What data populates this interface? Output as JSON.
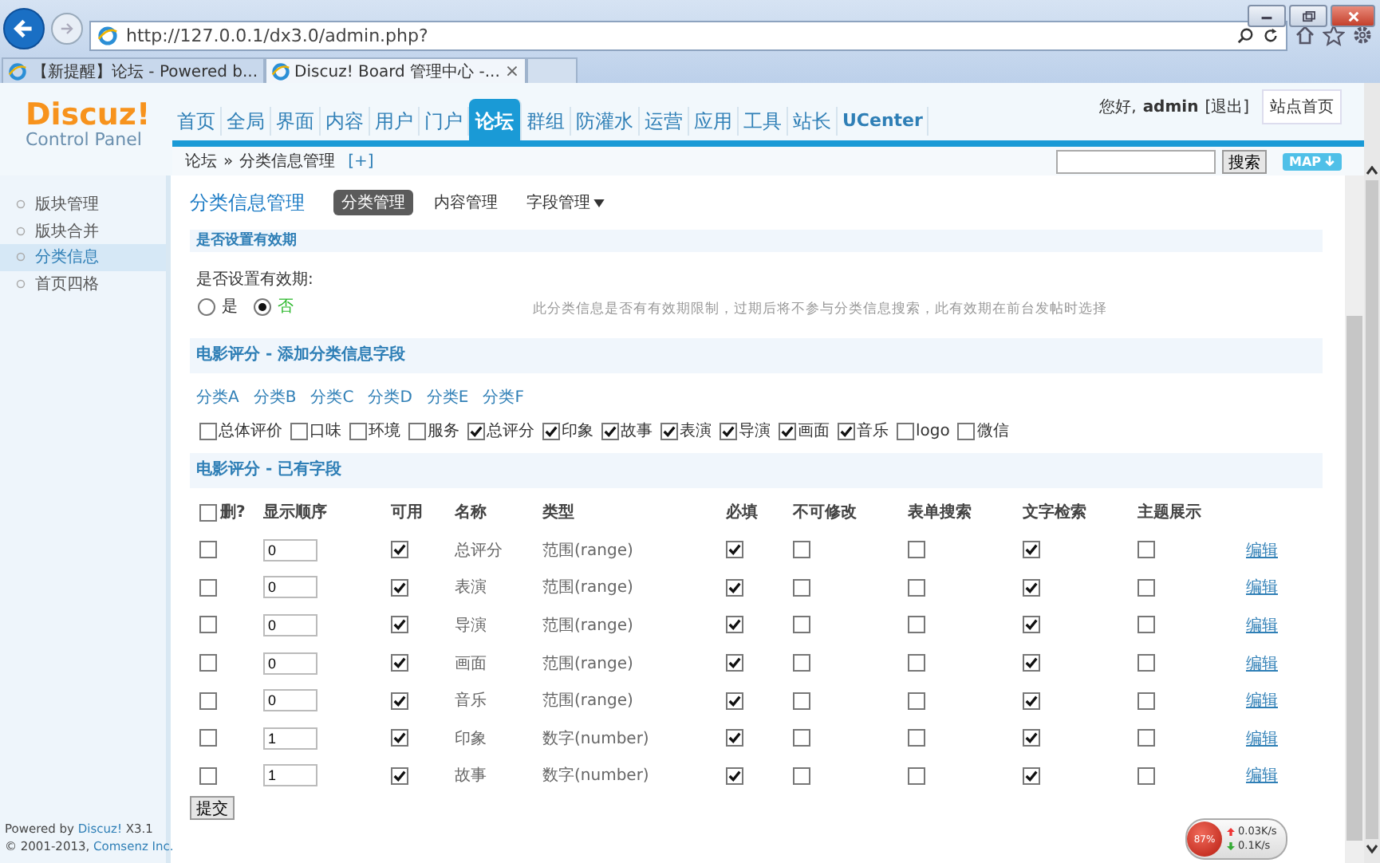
{
  "browser": {
    "address": "http://127.0.0.1/dx3.0/admin.php?",
    "tabs": [
      {
        "label": "【新提醒】论坛 - Powered b...",
        "selected": false
      },
      {
        "label": "Discuz! Board 管理中心 -...",
        "selected": true
      }
    ],
    "close": "×"
  },
  "header": {
    "logo": "Discuz!",
    "logo_sub": "Control Panel",
    "nav": [
      {
        "label": "首页",
        "selected": false
      },
      {
        "label": "全局",
        "selected": false
      },
      {
        "label": "界面",
        "selected": false
      },
      {
        "label": "内容",
        "selected": false
      },
      {
        "label": "用户",
        "selected": false
      },
      {
        "label": "门户",
        "selected": false
      },
      {
        "label": "论坛",
        "selected": true
      },
      {
        "label": "群组",
        "selected": false
      },
      {
        "label": "防灌水",
        "selected": false
      },
      {
        "label": "运营",
        "selected": false
      },
      {
        "label": "应用",
        "selected": false
      },
      {
        "label": "工具",
        "selected": false
      },
      {
        "label": "站长",
        "selected": false
      },
      {
        "label": "UCenter",
        "selected": false
      }
    ],
    "greeting": "您好,",
    "user": "admin",
    "logout": "[退出]",
    "site_home": "站点首页"
  },
  "breadcrumb": {
    "items": [
      "论坛",
      "分类信息管理"
    ],
    "separator": "»",
    "add": "[+]"
  },
  "search": {
    "button": "搜索",
    "map": "MAP"
  },
  "sidebar": {
    "items": [
      {
        "label": "版块管理",
        "selected": false
      },
      {
        "label": "版块合并",
        "selected": false
      },
      {
        "label": "分类信息",
        "selected": true
      },
      {
        "label": "首页四格",
        "selected": false
      }
    ]
  },
  "footer": {
    "powered": "Powered by",
    "brand": "Discuz!",
    "version": "X3.1",
    "copyright": "© 2001-2013,",
    "company": "Comsenz Inc."
  },
  "content": {
    "title": "分类信息管理",
    "tabs": [
      {
        "label": "分类管理",
        "selected": true,
        "has_menu": false
      },
      {
        "label": "内容管理",
        "selected": false,
        "has_menu": false
      },
      {
        "label": "字段管理",
        "selected": false,
        "has_menu": true
      }
    ],
    "expiry": {
      "section": "是否设置有效期",
      "label": "是否设置有效期:",
      "options": [
        {
          "label": "是",
          "selected": false
        },
        {
          "label": "否",
          "selected": true
        }
      ],
      "hint": "此分类信息是否有有效期限制，过期后将不参与分类信息搜索，此有效期在前台发帖时选择"
    },
    "add_fields": {
      "section": "电影评分 - 添加分类信息字段",
      "categories": [
        "分类A",
        "分类B",
        "分类C",
        "分类D",
        "分类E",
        "分类F"
      ],
      "fields": [
        {
          "label": "总体评价",
          "checked": false
        },
        {
          "label": "口味",
          "checked": false
        },
        {
          "label": "环境",
          "checked": false
        },
        {
          "label": "服务",
          "checked": false
        },
        {
          "label": "总评分",
          "checked": true
        },
        {
          "label": "印象",
          "checked": true
        },
        {
          "label": "故事",
          "checked": true
        },
        {
          "label": "表演",
          "checked": true
        },
        {
          "label": "导演",
          "checked": true
        },
        {
          "label": "画面",
          "checked": true
        },
        {
          "label": "音乐",
          "checked": true
        },
        {
          "label": "logo",
          "checked": false
        },
        {
          "label": "微信",
          "checked": false
        }
      ]
    },
    "existing": {
      "section": "电影评分 - 已有字段",
      "select_all": {
        "label": "删?",
        "checked": false
      },
      "columns": [
        "显示顺序",
        "可用",
        "名称",
        "类型",
        "必填",
        "不可修改",
        "表单搜索",
        "文字检索",
        "主题展示"
      ],
      "rows": [
        {
          "delete": false,
          "order": "0",
          "available": true,
          "name": "总评分",
          "type": "范围(range)",
          "required": true,
          "unmodifiable": false,
          "form_search": false,
          "text_search": true,
          "theme_display": false,
          "edit": "编辑"
        },
        {
          "delete": false,
          "order": "0",
          "available": true,
          "name": "表演",
          "type": "范围(range)",
          "required": true,
          "unmodifiable": false,
          "form_search": false,
          "text_search": true,
          "theme_display": false,
          "edit": "编辑"
        },
        {
          "delete": false,
          "order": "0",
          "available": true,
          "name": "导演",
          "type": "范围(range)",
          "required": true,
          "unmodifiable": false,
          "form_search": false,
          "text_search": true,
          "theme_display": false,
          "edit": "编辑"
        },
        {
          "delete": false,
          "order": "0",
          "available": true,
          "name": "画面",
          "type": "范围(range)",
          "required": true,
          "unmodifiable": false,
          "form_search": false,
          "text_search": true,
          "theme_display": false,
          "edit": "编辑"
        },
        {
          "delete": false,
          "order": "0",
          "available": true,
          "name": "音乐",
          "type": "范围(range)",
          "required": true,
          "unmodifiable": false,
          "form_search": false,
          "text_search": true,
          "theme_display": false,
          "edit": "编辑"
        },
        {
          "delete": false,
          "order": "1",
          "available": true,
          "name": "印象",
          "type": "数字(number)",
          "required": true,
          "unmodifiable": false,
          "form_search": false,
          "text_search": true,
          "theme_display": false,
          "edit": "编辑"
        },
        {
          "delete": false,
          "order": "1",
          "available": true,
          "name": "故事",
          "type": "数字(number)",
          "required": true,
          "unmodifiable": false,
          "form_search": false,
          "text_search": true,
          "theme_display": false,
          "edit": "编辑"
        }
      ],
      "submit": "提交"
    }
  },
  "net_widget": {
    "percent": "87%",
    "up": "0.03K/s",
    "down": "0.1K/s"
  }
}
